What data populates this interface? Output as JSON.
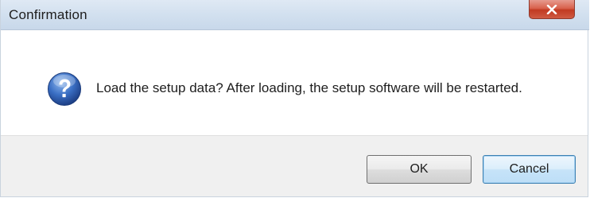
{
  "window": {
    "title": "Confirmation",
    "close_icon": "close-x-icon"
  },
  "message": {
    "icon": "question-icon",
    "text": "Load the setup data? After loading, the setup software will be restarted."
  },
  "buttons": {
    "ok_label": "OK",
    "cancel_label": "Cancel"
  },
  "colors": {
    "titlebar": "#d2e0ef",
    "close_button": "#c94a33",
    "question_icon": "#2a5fb0",
    "footer": "#f0f0f0",
    "default_button_border": "#3c7fb1"
  }
}
